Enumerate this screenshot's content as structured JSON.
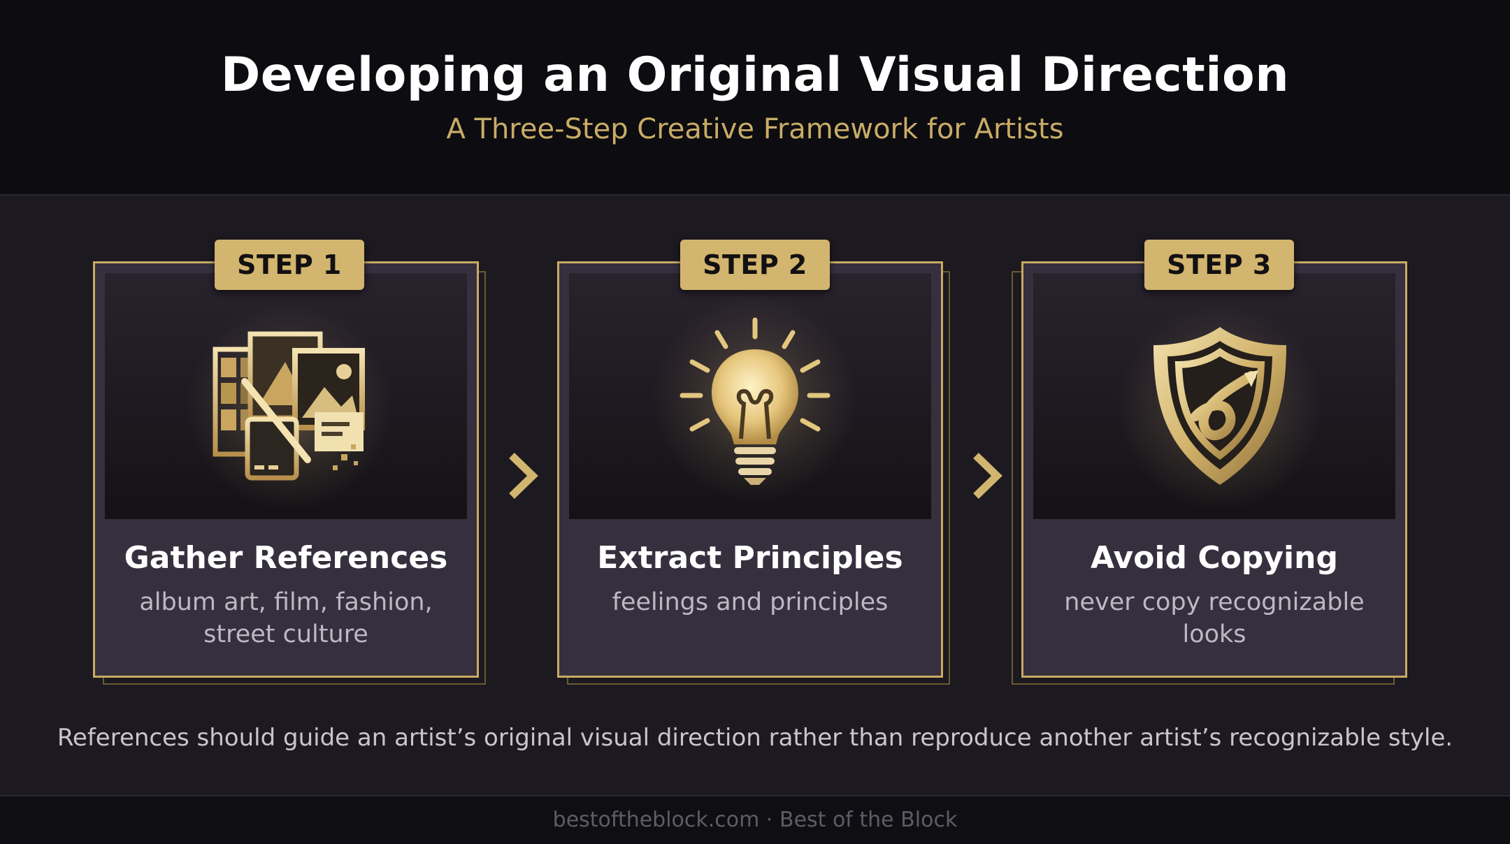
{
  "header": {
    "title": "Developing an Original Visual Direction",
    "subtitle": "A Three-Step Creative Framework for Artists"
  },
  "steps": [
    {
      "badge": "STEP 1",
      "title": "Gather References",
      "description": "album art, film, fashion, street culture",
      "icon": "image-collage-icon"
    },
    {
      "badge": "STEP 2",
      "title": "Extract Principles",
      "description": "feelings and principles",
      "icon": "lightbulb-icon"
    },
    {
      "badge": "STEP 3",
      "title": "Avoid Copying",
      "description": "never copy recognizable looks",
      "icon": "shield-icon"
    }
  ],
  "arrows": [
    "chevron-right-icon",
    "chevron-right-icon"
  ],
  "caption": "References should guide an artist’s original visual direction rather than reproduce another artist’s recognizable style.",
  "footer": {
    "text": "bestoftheblock.com · Best of the Block"
  },
  "colors": {
    "accent_gold": "#c8aa63",
    "background": "#1c1a20",
    "header_bg": "#0d0c10"
  }
}
